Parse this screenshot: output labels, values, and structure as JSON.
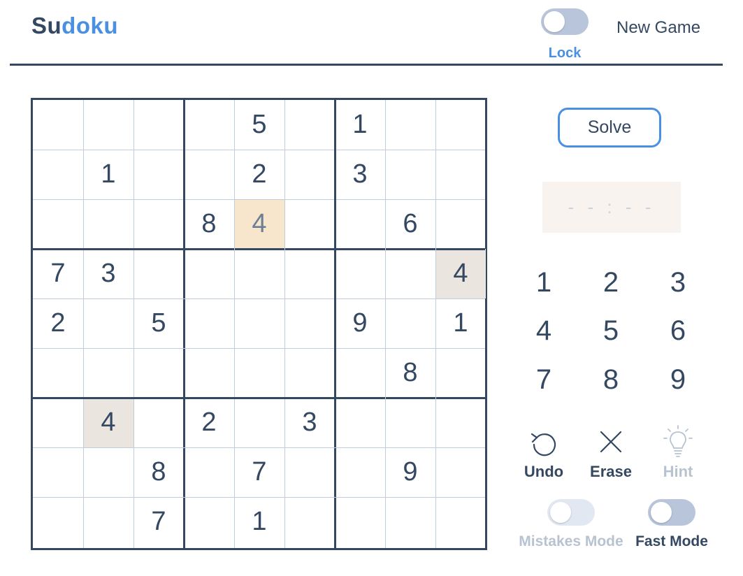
{
  "header": {
    "title_part1": "Su",
    "title_part2": "doku",
    "lock_label": "Lock",
    "new_game_label": "New Game"
  },
  "colors": {
    "accent": "#4a90e2",
    "text": "#344861",
    "selected_cell": "#f8e6cc",
    "same_number_cell": "#ebe5e0",
    "muted": "#b8c3d0"
  },
  "grid": [
    [
      "",
      "",
      "",
      "",
      "5",
      "",
      "1",
      "",
      ""
    ],
    [
      "",
      "1",
      "",
      "",
      "2",
      "",
      "3",
      "",
      ""
    ],
    [
      "",
      "",
      "",
      "8",
      "4",
      "",
      "",
      "6",
      ""
    ],
    [
      "7",
      "3",
      "",
      "",
      "",
      "",
      "",
      "",
      "4"
    ],
    [
      "2",
      "",
      "5",
      "",
      "",
      "",
      "9",
      "",
      "1"
    ],
    [
      "",
      "",
      "",
      "",
      "",
      "",
      "",
      "8",
      ""
    ],
    [
      "",
      "4",
      "",
      "2",
      "",
      "3",
      "",
      "",
      ""
    ],
    [
      "",
      "",
      "8",
      "",
      "7",
      "",
      "",
      "9",
      ""
    ],
    [
      "",
      "",
      "7",
      "",
      "1",
      "",
      "",
      "",
      ""
    ]
  ],
  "selected_cell": {
    "row": 2,
    "col": 4
  },
  "highlighted_cells": [
    {
      "row": 3,
      "col": 8
    },
    {
      "row": 6,
      "col": 1
    }
  ],
  "solve_label": "Solve",
  "timer_text": "- - : - -",
  "numpad": [
    "1",
    "2",
    "3",
    "4",
    "5",
    "6",
    "7",
    "8",
    "9"
  ],
  "tools": {
    "undo_label": "Undo",
    "erase_label": "Erase",
    "hint_label": "Hint"
  },
  "modes": {
    "mistakes_label": "Mistakes Mode",
    "fast_label": "Fast Mode"
  }
}
